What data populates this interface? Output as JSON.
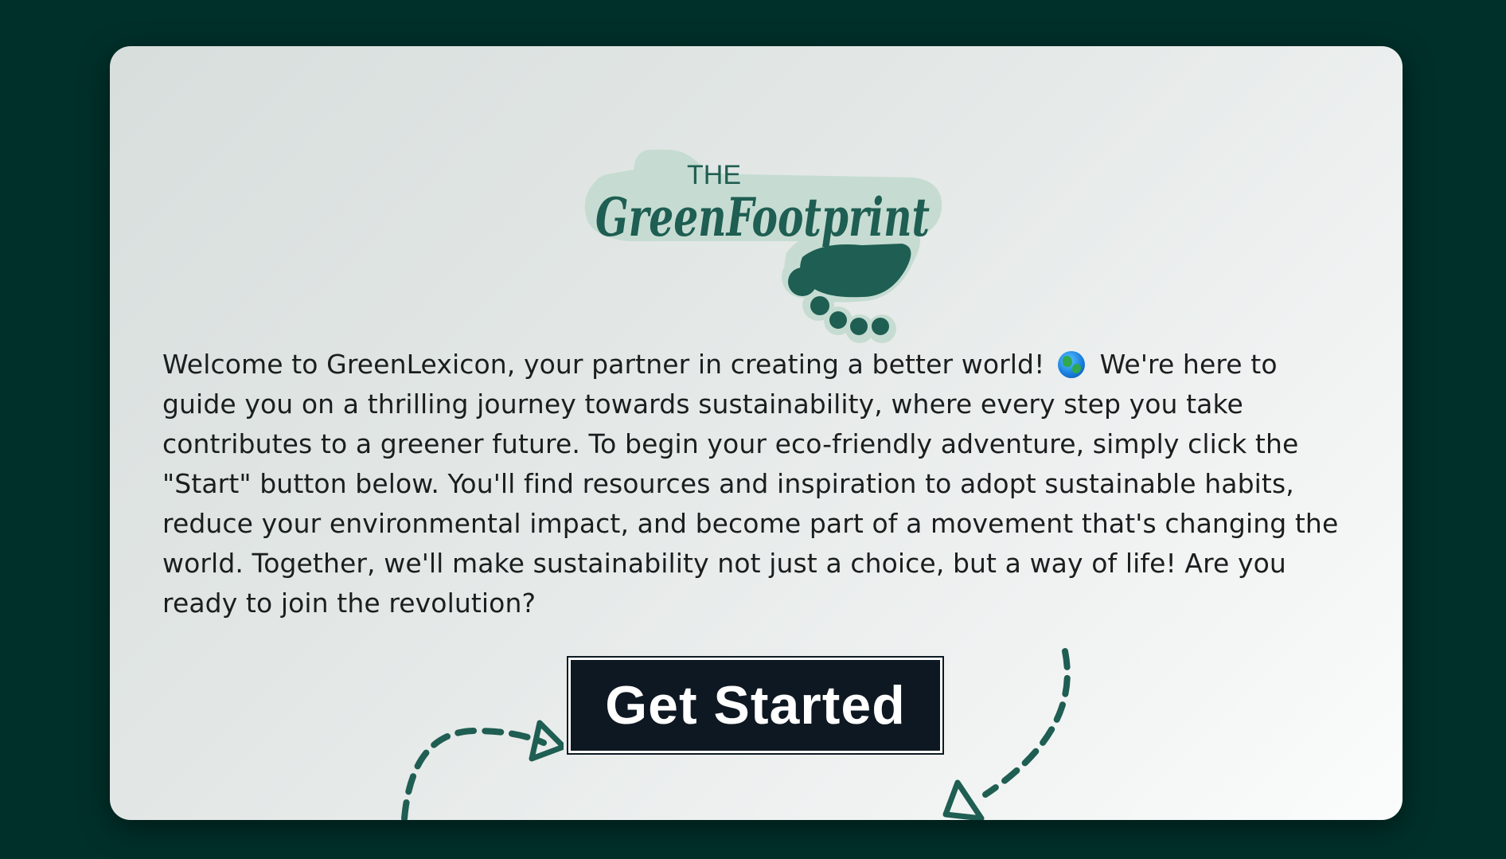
{
  "logo": {
    "the": "THE",
    "brand": "GreenFootprint"
  },
  "intro": {
    "part1": "Welcome to GreenLexicon, your partner in creating a better world!",
    "globe_icon": "earth-globe-icon",
    "part2": "We're here to guide you on a thrilling journey towards sustainability, where every step you take contributes to a greener future. To begin your eco-friendly adventure, simply click the \"Start\" button below. You'll find resources and inspiration to adopt sustainable habits, reduce your environmental impact, and become part of a movement that's changing the world. Together, we'll make sustainability not just a choice, but a way of life! Are you ready to join the revolution?"
  },
  "cta": {
    "label": "Get Started"
  },
  "colors": {
    "background": "#00302a",
    "brand_green": "#1f5e52",
    "button": "#0e1822"
  }
}
